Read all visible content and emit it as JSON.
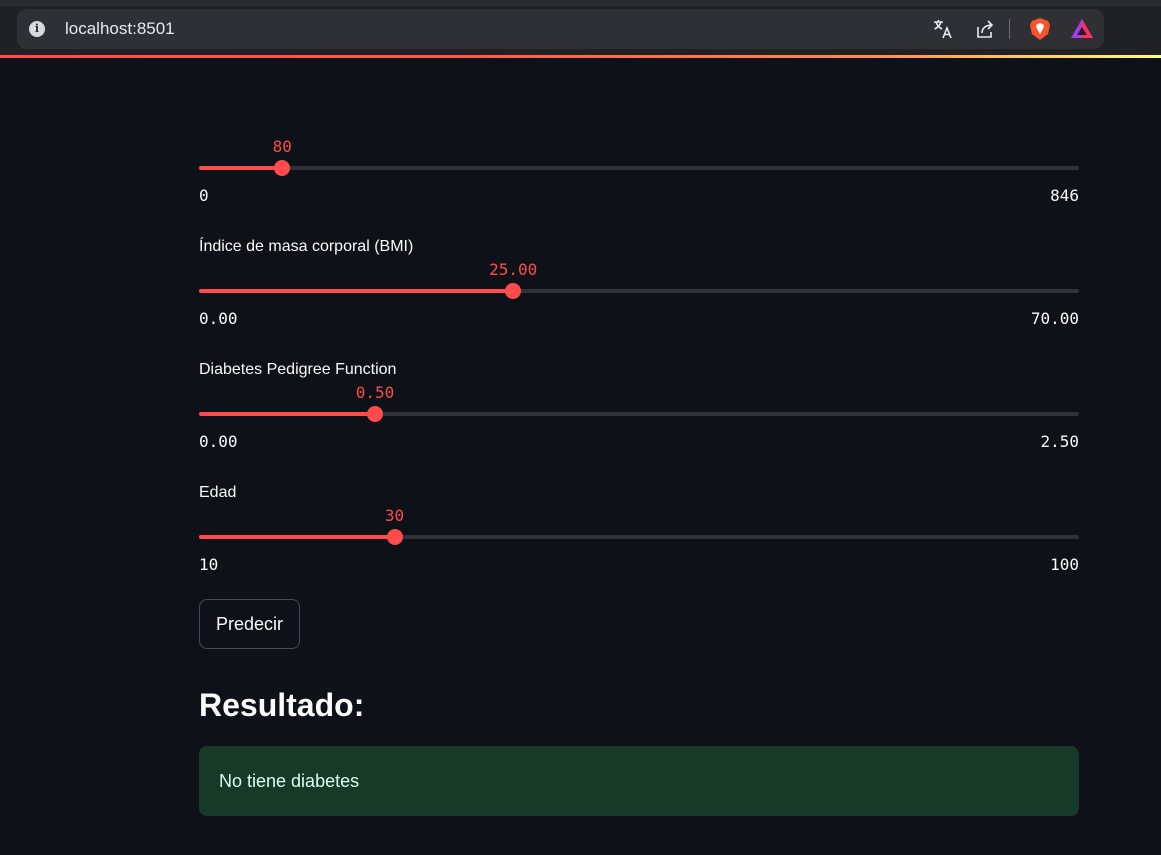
{
  "browser": {
    "url": "localhost:8501",
    "icons": [
      "info-icon",
      "translate-icon",
      "share-icon",
      "brave-shield-icon",
      "brave-rewards-icon"
    ]
  },
  "sliders": [
    {
      "label": "",
      "value": "80",
      "min": "0",
      "max": "846",
      "fraction": 0.0946
    },
    {
      "label": "Índice de masa corporal (BMI)",
      "value": "25.00",
      "min": "0.00",
      "max": "70.00",
      "fraction": 0.3571
    },
    {
      "label": "Diabetes Pedigree Function",
      "value": "0.50",
      "min": "0.00",
      "max": "2.50",
      "fraction": 0.2
    },
    {
      "label": "Edad",
      "value": "30",
      "min": "10",
      "max": "100",
      "fraction": 0.2222
    }
  ],
  "button": {
    "label": "Predecir"
  },
  "result": {
    "heading": "Resultado:",
    "message": "No tiene diabetes"
  },
  "colors": {
    "accent": "#ff4b4b",
    "background": "#0e1117",
    "success_bg": "#173928",
    "success_text": "#dffde9"
  }
}
